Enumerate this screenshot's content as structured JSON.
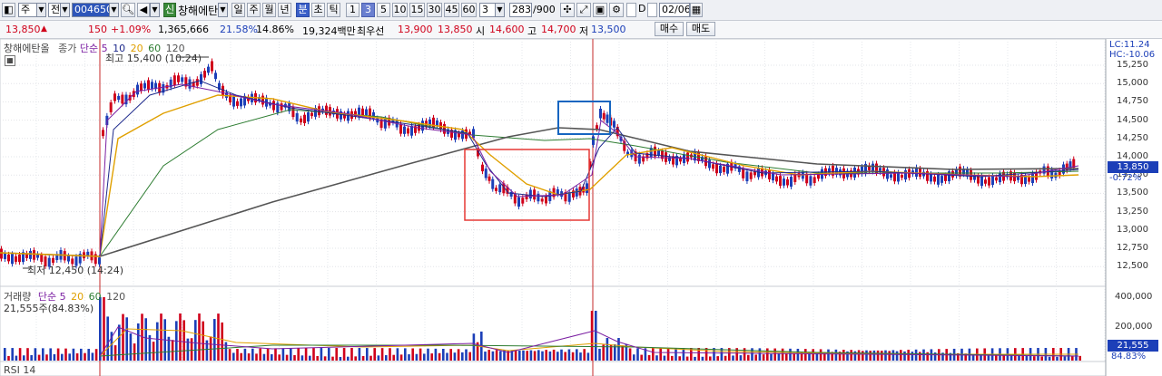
{
  "toolbar": {
    "period_unit": "주",
    "period_kind": "전",
    "stock_code": "004650",
    "credit_badge": "신",
    "stock_name": "창해에탄올",
    "period_buttons": [
      "일",
      "주",
      "월",
      "년",
      "분",
      "초",
      "틱"
    ],
    "selected_period": "분",
    "interval_buttons": [
      "1",
      "3",
      "5",
      "10",
      "15",
      "30",
      "45",
      "60"
    ],
    "selected_interval": "3",
    "interval_value": "3",
    "count_value": "283",
    "count_max": "/900",
    "date_value": "02/06",
    "checkbox_d_label": "D"
  },
  "quote": {
    "price": "13,850",
    "direction": "▲",
    "change": "150",
    "change_pct": "+1.09%",
    "volume": "1,365,666",
    "turnover_pct": "21.58%",
    "ratio": "14.86%",
    "amount": "19,324백만",
    "best_ask_label": "최우선",
    "best_ask": "13,900",
    "best_bid": "13,850",
    "open_label": "시",
    "open": "14,600",
    "high_label": "고",
    "high": "14,700",
    "low_label": "저",
    "low": "13,500",
    "buy_button": "매수",
    "sell_button": "매도"
  },
  "price_panel": {
    "stock_name": "창해에탄올",
    "legend_label": "종가",
    "ma_type": "단순",
    "ma_periods": [
      "5",
      "10",
      "20",
      "60",
      "120"
    ],
    "high_annotation": "최고 15,400 (10:24)",
    "low_annotation": "최저 12,450 (14:24)",
    "lc_label": "LC:11.24",
    "hc_label": "HC:-10.06",
    "y_ticks": [
      "15,250",
      "15,000",
      "14,750",
      "14,500",
      "14,250",
      "14,000",
      "13,750",
      "13,500",
      "13,250",
      "13,000",
      "12,750",
      "12,500"
    ],
    "current_price_tag": "13,850",
    "current_pct_tag": "-0.72%"
  },
  "volume_panel": {
    "legend_label": "거래량",
    "ma_type": "단순",
    "ma_periods": [
      "5",
      "20",
      "60",
      "120"
    ],
    "current_volume": "21,555주(84.83%)",
    "y_ticks": [
      "400,000",
      "200,000"
    ],
    "current_tag": "21,555",
    "current_pct_tag": "84.83%"
  },
  "rsi_panel": {
    "legend_label": "RSI 14"
  },
  "colors": {
    "up": "#d0021b",
    "down": "#1c3fb8",
    "ma5": "#7b1fa2",
    "ma10": "#1e2a8c",
    "ma20": "#e0a000",
    "ma60": "#2e7d32",
    "ma120": "#555555",
    "highlight_red": "#e53935",
    "highlight_blue": "#1565c0"
  }
}
